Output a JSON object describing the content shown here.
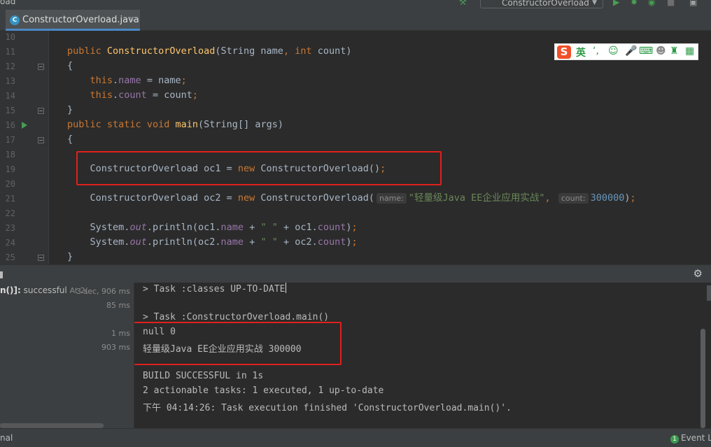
{
  "window": {
    "breadcrumb_fragment": "oad",
    "run_configuration": "ConstructorOverload"
  },
  "tabs": [
    {
      "label": "ConstructorOverload.java",
      "icon": "java-class-icon",
      "active": true
    }
  ],
  "editor": {
    "line_numbers": [
      "10",
      "11",
      "12",
      "13",
      "14",
      "15",
      "16",
      "17",
      "18",
      "19",
      "20",
      "21",
      "22",
      "23",
      "24",
      "25"
    ],
    "hints": {
      "name": "name:",
      "count": "count:"
    },
    "tokens": {
      "public": "public",
      "static": "static",
      "void": "void",
      "int": "int",
      "this": "this",
      "new": "new",
      "class_name": "ConstructorOverload",
      "string_type": "String",
      "system": "System",
      "out": "out",
      "println": "println",
      "main": "main",
      "name": "name",
      "count": "count",
      "args": "args",
      "oc1": "oc1",
      "oc2": "oc2",
      "str_arg": "\"轻量级Java EE企业应用实战\"",
      "num_arg": "300000",
      "space_str": "\" \""
    }
  },
  "ime_toolbar": {
    "logo": "S",
    "mode": "英",
    "icons": [
      "punctuation-icon",
      "emoji-icon",
      "microphone-icon",
      "keyboard-icon",
      "user-icon",
      "skin-icon",
      "grid-icon"
    ]
  },
  "run_panel": {
    "tree": {
      "item_prefix": "n()]:",
      "item_status": "successful",
      "item_at": "At 2(",
      "item_time": "3 sec, 906 ms",
      "durations": [
        "85 ms",
        "1 ms",
        "903 ms"
      ]
    },
    "console_lines": [
      "> Task :classes UP-TO-DATE",
      "",
      "> Task :ConstructorOverload.main()",
      "null 0",
      "轻量级Java EE企业应用实战 300000",
      "",
      "BUILD SUCCESSFUL in 1s",
      "2 actionable tasks: 1 executed, 1 up-to-date",
      "下午 04:14:26: Task execution finished 'ConstructorOverload.main()'."
    ]
  },
  "statusbar": {
    "left_text": "nal",
    "event_log": "Event Lo",
    "event_count": "1"
  },
  "colors": {
    "keyword": "#cc7832",
    "field": "#9876aa",
    "string": "#6a8759",
    "number": "#6897bb",
    "method": "#ffc66d",
    "highlight_box": "#e0201c"
  }
}
